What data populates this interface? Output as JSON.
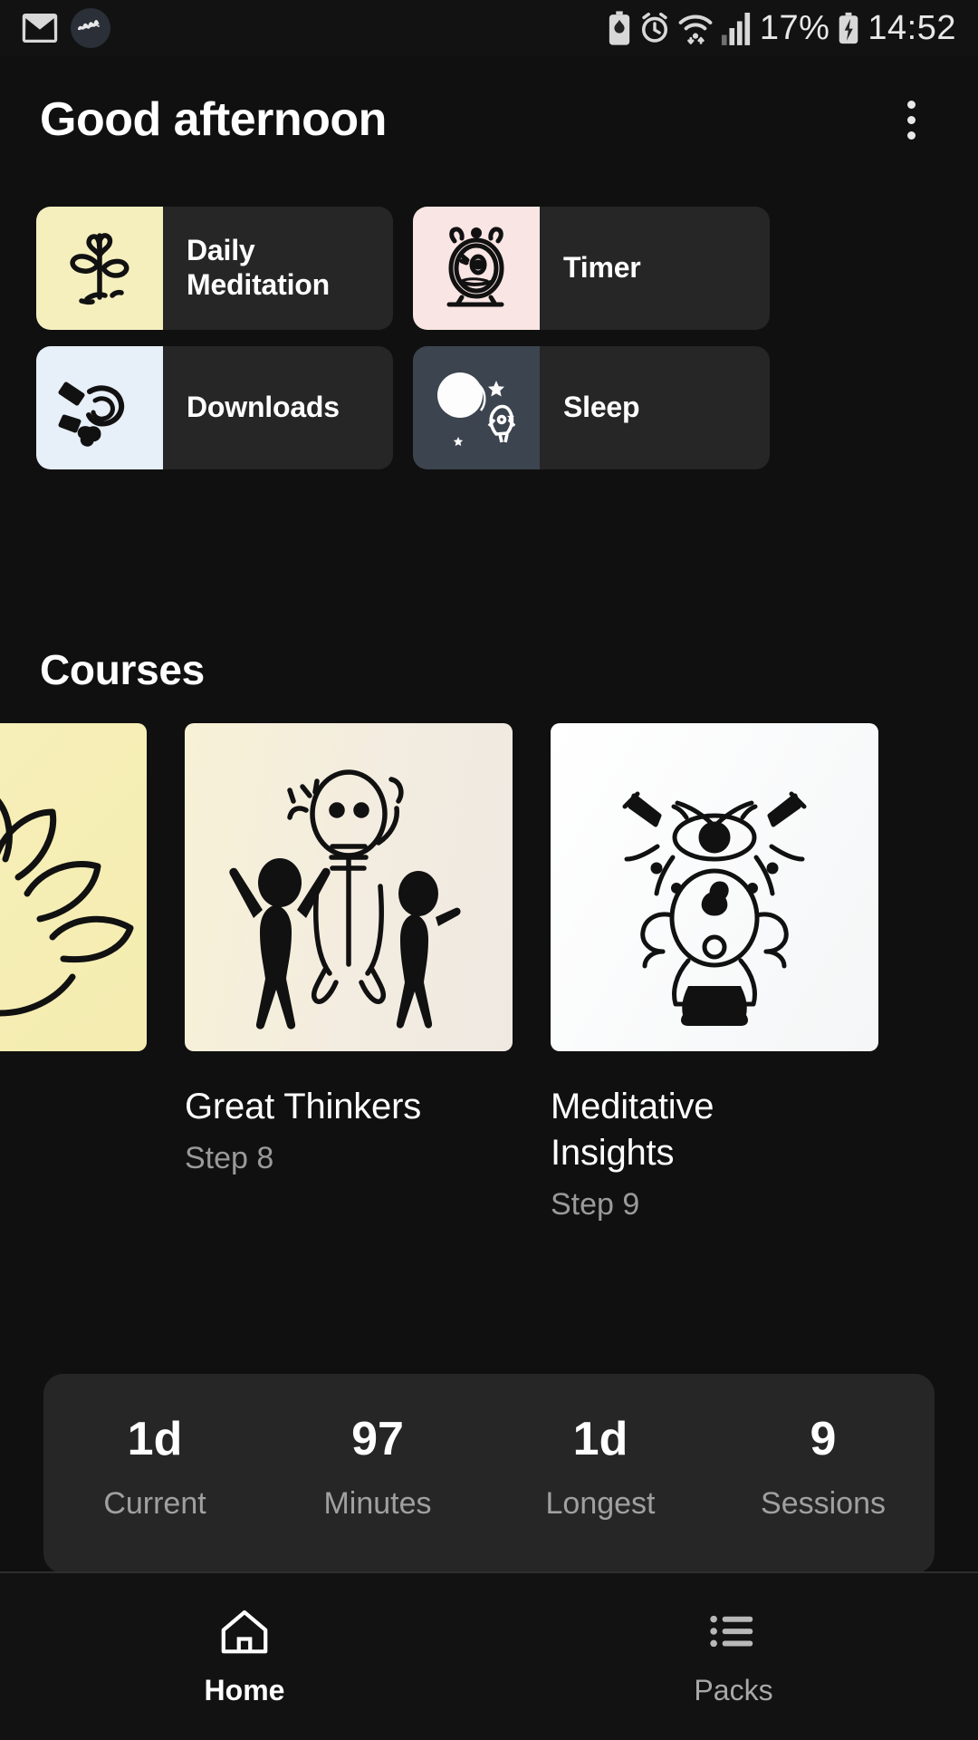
{
  "status_bar": {
    "icons_left": [
      "envelope-icon",
      "app-badge-icon"
    ],
    "icons_right": [
      "battery-saver-icon",
      "alarm-icon",
      "wifi-icon",
      "signal-icon",
      "charging-battery-icon"
    ],
    "battery_percent": "17%",
    "time": "14:52"
  },
  "header": {
    "greeting": "Good afternoon",
    "menu_icon": "kebab-menu-icon"
  },
  "quick_tiles": [
    {
      "label": "Daily Meditation",
      "icon": "plant-heart-icon",
      "thumb_color": "#f5efbe"
    },
    {
      "label": "Timer",
      "icon": "alarm-clock-icon",
      "thumb_color": "#f9e5e3"
    },
    {
      "label": "Downloads",
      "icon": "headphones-icon",
      "thumb_color": "#e7eff9"
    },
    {
      "label": "Sleep",
      "icon": "moon-star-icon",
      "thumb_color": "#3c444f"
    }
  ],
  "courses_section": {
    "title": "Courses",
    "items": [
      {
        "title": "",
        "step": "",
        "icon": "lotus-icon",
        "bg": "#f6eeb8",
        "clipped": true
      },
      {
        "title": "Great Thinkers",
        "step": "Step 8",
        "icon": "thinkers-icon",
        "bg": "#f4eedc"
      },
      {
        "title": "Meditative Insights",
        "step": "Step 9",
        "icon": "third-eye-icon",
        "bg": "#fbfbfb"
      }
    ]
  },
  "stats": [
    {
      "value": "1d",
      "label": "Current"
    },
    {
      "value": "97",
      "label": "Minutes"
    },
    {
      "value": "1d",
      "label": "Longest"
    },
    {
      "value": "9",
      "label": "Sessions"
    }
  ],
  "bottom_nav": [
    {
      "label": "Home",
      "icon": "home-icon",
      "active": true
    },
    {
      "label": "Packs",
      "icon": "list-icon",
      "active": false
    }
  ],
  "colors": {
    "background": "#101010",
    "surface": "#262626",
    "text_primary": "#ffffff",
    "text_secondary": "#9a9a9a"
  }
}
